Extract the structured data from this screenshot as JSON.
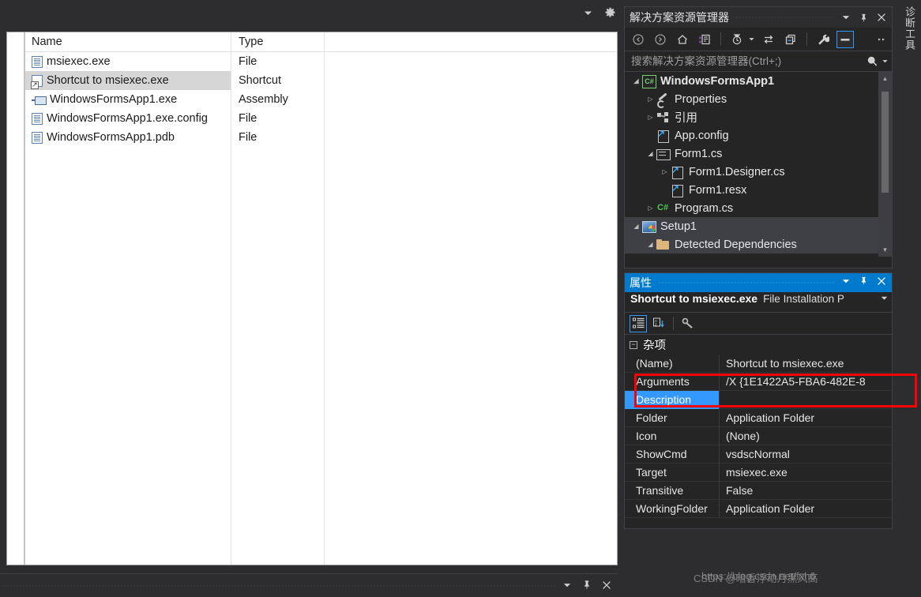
{
  "topbar": {
    "dropdown_icon": "chevron-down-icon",
    "settings_icon": "gear-icon"
  },
  "file_list": {
    "columns": [
      "Name",
      "Type"
    ],
    "rows": [
      {
        "name": "msiexec.exe",
        "type": "File",
        "icon": "document-icon",
        "selected": false
      },
      {
        "name": "Shortcut to msiexec.exe",
        "type": "Shortcut",
        "icon": "shortcut-icon",
        "selected": true
      },
      {
        "name": "WindowsFormsApp1.exe",
        "type": "Assembly",
        "icon": "assembly-icon",
        "selected": false
      },
      {
        "name": "WindowsFormsApp1.exe.config",
        "type": "File",
        "icon": "document-icon",
        "selected": false
      },
      {
        "name": "WindowsFormsApp1.pdb",
        "type": "File",
        "icon": "document-icon",
        "selected": false
      }
    ]
  },
  "vertical_tab": {
    "label": "诊断工具"
  },
  "solution_explorer": {
    "title": "解决方案资源管理器",
    "title_buttons": [
      "chevron-down-icon",
      "pin-icon",
      "close-icon"
    ],
    "toolbar": [
      "back-icon",
      "forward-icon",
      "home-icon",
      "view-designer-icon",
      "pending-changes-icon",
      "sync-with-active-document-icon",
      "collapse-all-icon",
      "properties-wrench-icon",
      "show-all-files-icon"
    ],
    "search_placeholder": "搜索解决方案资源管理器(Ctrl+;)",
    "search_value": "",
    "search_icon": "search-icon",
    "tree": [
      {
        "label": "WindowsFormsApp1",
        "indent": 0,
        "arrow": "expanded",
        "icon": "csharp-project-icon",
        "bold": true,
        "selected": false
      },
      {
        "label": "Properties",
        "indent": 1,
        "arrow": "collapsed",
        "icon": "wrench-icon",
        "bold": false,
        "selected": false
      },
      {
        "label": "引用",
        "indent": 1,
        "arrow": "collapsed",
        "icon": "references-icon",
        "bold": false,
        "selected": false
      },
      {
        "label": "App.config",
        "indent": 2,
        "arrow": "none",
        "icon": "config-file-icon",
        "bold": false,
        "selected": false
      },
      {
        "label": "Form1.cs",
        "indent": 1,
        "arrow": "expanded",
        "icon": "form-icon",
        "bold": false,
        "selected": false
      },
      {
        "label": "Form1.Designer.cs",
        "indent": 2,
        "arrow": "collapsed",
        "icon": "designer-file-icon",
        "bold": false,
        "selected": false
      },
      {
        "label": "Form1.resx",
        "indent": 3,
        "arrow": "none",
        "icon": "resx-file-icon",
        "bold": false,
        "selected": false
      },
      {
        "label": "Program.cs",
        "indent": 1,
        "arrow": "collapsed",
        "icon": "csharp-file-icon",
        "bold": false,
        "selected": false
      },
      {
        "label": "Setup1",
        "indent": 0,
        "arrow": "expanded",
        "icon": "setup-project-icon",
        "bold": false,
        "selected": true
      },
      {
        "label": "Detected Dependencies",
        "indent": 1,
        "arrow": "expanded",
        "icon": "folder-icon",
        "bold": false,
        "selected": false
      }
    ],
    "scrollbar": {
      "up_icon": "scroll-up-icon",
      "down_icon": "scroll-down-icon"
    }
  },
  "properties_panel": {
    "title": "属性",
    "title_buttons": [
      "chevron-down-icon",
      "pin-icon",
      "close-icon"
    ],
    "object_name": "Shortcut to msiexec.exe",
    "object_type": "File Installation P",
    "object_dropdown_icon": "chevron-down-icon",
    "toolbar": [
      "categorized-icon",
      "alphabetical-icon",
      "property-pages-icon"
    ],
    "category": "杂项",
    "category_toggle": "−",
    "rows": [
      {
        "key": "(Name)",
        "value": "Shortcut to msiexec.exe",
        "selected": false
      },
      {
        "key": "Arguments",
        "value": "/X {1E1422A5-FBA6-482E-8",
        "selected": false
      },
      {
        "key": "Description",
        "value": "",
        "selected": true
      },
      {
        "key": "Folder",
        "value": "Application Folder",
        "selected": false
      },
      {
        "key": "Icon",
        "value": "(None)",
        "selected": false
      },
      {
        "key": "ShowCmd",
        "value": "vsdscNormal",
        "selected": false
      },
      {
        "key": "Target",
        "value": "msiexec.exe",
        "selected": false
      },
      {
        "key": "Transitive",
        "value": "False",
        "selected": false
      },
      {
        "key": "WorkingFolder",
        "value": "Application Folder",
        "selected": false
      }
    ]
  },
  "bottom_bar": {
    "buttons": [
      "chevron-down-icon",
      "pin-icon",
      "close-icon"
    ]
  },
  "watermarks": {
    "primary": "CSDN @暗香浮动月黑风高",
    "secondary": "https://blog.csdn.net/fxh6"
  },
  "colors": {
    "accent_blue": "#007acc",
    "selection_blue": "#3399ff",
    "annotation_red": "#ff0000",
    "panel_bg": "#252526",
    "chrome_bg": "#2d2d30"
  }
}
